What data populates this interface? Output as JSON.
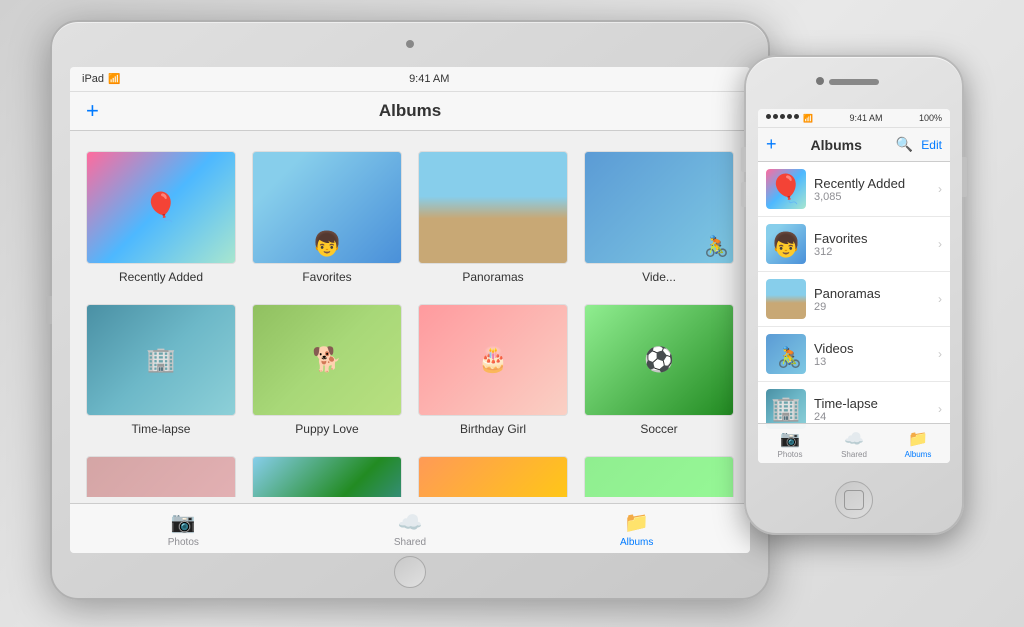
{
  "scene": {
    "bg_color": "#e0e0e0"
  },
  "ipad": {
    "status": {
      "device": "iPad",
      "wifi": "WiFi",
      "time": "9:41 AM"
    },
    "navbar": {
      "plus_label": "+",
      "title": "Albums"
    },
    "albums": [
      {
        "name": "Recently Added",
        "thumb_class": "thumb-recently-added"
      },
      {
        "name": "Favorites",
        "thumb_class": "thumb-favorites"
      },
      {
        "name": "Panoramas",
        "thumb_class": "thumb-panoramas"
      },
      {
        "name": "Videos",
        "thumb_class": "thumb-videos"
      },
      {
        "name": "Time-lapse",
        "thumb_class": "thumb-timelapse"
      },
      {
        "name": "Puppy Love",
        "thumb_class": "thumb-puppylove"
      },
      {
        "name": "Birthday Girl",
        "thumb_class": "thumb-birthday"
      },
      {
        "name": "Soccer",
        "thumb_class": "thumb-soccer"
      },
      {
        "name": "",
        "thumb_class": "thumb-r3"
      },
      {
        "name": "",
        "thumb_class": "thumb-r4"
      },
      {
        "name": "",
        "thumb_class": "thumb-r5"
      },
      {
        "name": "",
        "thumb_class": "thumb-r6"
      }
    ],
    "tabbar": {
      "tabs": [
        {
          "label": "Photos",
          "icon": "📷",
          "active": false
        },
        {
          "label": "Shared",
          "icon": "☁️",
          "active": false
        },
        {
          "label": "Albums",
          "icon": "📁",
          "active": true
        }
      ]
    }
  },
  "iphone": {
    "status": {
      "time": "9:41 AM",
      "battery": "100%"
    },
    "navbar": {
      "plus_label": "+",
      "title": "Albums",
      "search_label": "🔍",
      "edit_label": "Edit"
    },
    "albums": [
      {
        "name": "Recently Added",
        "count": "3,085",
        "thumb_class": "thumb-recently-added"
      },
      {
        "name": "Favorites",
        "count": "312",
        "thumb_class": "thumb-favorites"
      },
      {
        "name": "Panoramas",
        "count": "29",
        "thumb_class": "thumb-panoramas"
      },
      {
        "name": "Videos",
        "count": "13",
        "thumb_class": "thumb-videos"
      },
      {
        "name": "Time-lapse",
        "count": "24",
        "thumb_class": "thumb-timelapse"
      }
    ],
    "tabbar": {
      "tabs": [
        {
          "label": "Photos",
          "icon": "📷",
          "active": false
        },
        {
          "label": "Shared",
          "icon": "☁️",
          "active": false
        },
        {
          "label": "Albums",
          "icon": "📁",
          "active": true
        }
      ]
    }
  }
}
